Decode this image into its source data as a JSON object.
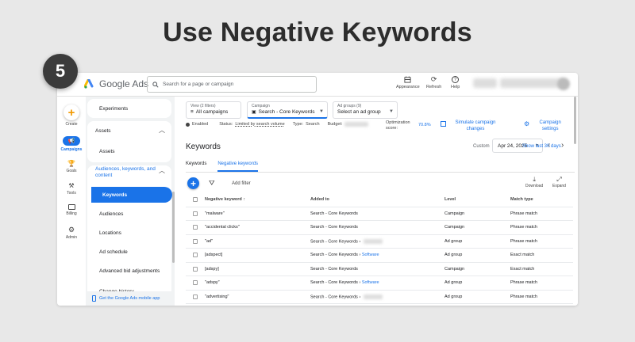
{
  "headline": "Use Negative Keywords",
  "step": "5",
  "topbar": {
    "app_name": "Google Ads",
    "search_placeholder": "Search for a page or campaign",
    "appearance": "Appearance",
    "refresh": "Refresh",
    "help": "Help"
  },
  "rail": [
    {
      "label": "Create",
      "icon": "create-icon"
    },
    {
      "label": "Campaigns",
      "icon": "campaigns-icon"
    },
    {
      "label": "Goals",
      "icon": "goals-icon"
    },
    {
      "label": "Tools",
      "icon": "tools-icon"
    },
    {
      "label": "Billing",
      "icon": "billing-icon"
    },
    {
      "label": "Admin",
      "icon": "admin-icon"
    }
  ],
  "sidebar": {
    "experiments": "Experiments",
    "assets_header": "Assets",
    "assets": "Assets",
    "audiences_header": "Audiences, keywords, and content",
    "items": [
      "Keywords",
      "Audiences",
      "Locations",
      "Ad schedule",
      "Advanced bid adjustments"
    ],
    "change_history": "Change history",
    "mobile_app": "Get the Google Ads mobile app"
  },
  "filters": {
    "view_label": "View (2 filters)",
    "view_value": "All campaigns",
    "campaign_label": "Campaign",
    "campaign_value": "Search - Core Keywords",
    "adgroups_label": "Ad groups (9)",
    "adgroups_value": "Select an ad group"
  },
  "status": {
    "enabled": "Enabled",
    "status_label": "Status:",
    "status_value": "Limited by search volume",
    "type_label": "Type:",
    "type_value": "Search",
    "budget_label": "Budget:",
    "opt_label": "Optimization score:",
    "opt_value": "70.8%",
    "simulate": "Simulate campaign changes",
    "settings": "Campaign settings"
  },
  "page": {
    "title": "Keywords",
    "custom": "Custom",
    "date": "Apr 24, 2025",
    "show_last": "Show last 30 days",
    "tabs": [
      "Keywords",
      "Negative keywords"
    ],
    "add_filter": "Add filter",
    "download": "Download",
    "expand": "Expand"
  },
  "table": {
    "headers": [
      "Negative keyword",
      "Added to",
      "Level",
      "Match type"
    ],
    "rows": [
      {
        "kw": "\"malware\"",
        "added": "Search - Core Keywords",
        "extra": "",
        "blur": false,
        "level": "Campaign",
        "match": "Phrase match"
      },
      {
        "kw": "\"accidental clicks\"",
        "added": "Search - Core Keywords",
        "extra": "",
        "blur": false,
        "level": "Campaign",
        "match": "Phrase match"
      },
      {
        "kw": "\"ad\"",
        "added": "Search - Core Keywords ›",
        "extra": "",
        "blur": true,
        "level": "Ad group",
        "match": "Phrase match"
      },
      {
        "kw": "[adspect]",
        "added": "Search - Core Keywords ›",
        "extra": "Software",
        "blur": false,
        "level": "Ad group",
        "match": "Exact match"
      },
      {
        "kw": "[adspy]",
        "added": "Search - Core Keywords",
        "extra": "",
        "blur": false,
        "level": "Campaign",
        "match": "Exact match"
      },
      {
        "kw": "\"adspy\"",
        "added": "Search - Core Keywords ›",
        "extra": "Software",
        "blur": false,
        "level": "Ad group",
        "match": "Phrase match"
      },
      {
        "kw": "\"advertising\"",
        "added": "Search - Core Keywords ›",
        "extra": "",
        "blur": true,
        "level": "Ad group",
        "match": "Phrase match"
      }
    ]
  },
  "colors": {
    "accent": "#1a73e8",
    "background": "#e8e8e8"
  }
}
